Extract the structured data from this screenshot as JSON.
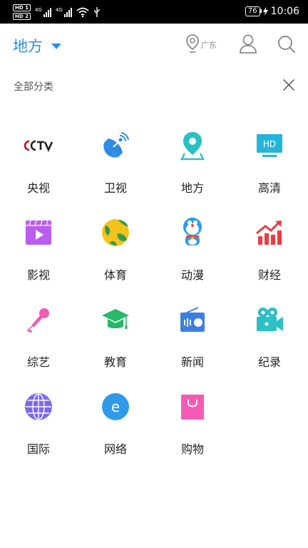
{
  "status_bar": {
    "hd1": "HD 1",
    "hd2": "HD 2",
    "net1": "4G",
    "net2": "4G",
    "battery": "76",
    "time": "10:06"
  },
  "header": {
    "title": "地方",
    "location_label": "广东"
  },
  "category_bar": {
    "label": "全部分类"
  },
  "categories": [
    {
      "label": "央视",
      "icon": "cctv-logo-icon"
    },
    {
      "label": "卫视",
      "icon": "satellite-dish-icon"
    },
    {
      "label": "地方",
      "icon": "map-pin-icon"
    },
    {
      "label": "高清",
      "icon": "hd-monitor-icon",
      "icon_text": "HD"
    },
    {
      "label": "影视",
      "icon": "film-play-icon"
    },
    {
      "label": "体育",
      "icon": "soccer-ball-icon"
    },
    {
      "label": "动漫",
      "icon": "doraemon-icon"
    },
    {
      "label": "财经",
      "icon": "finance-chart-icon"
    },
    {
      "label": "综艺",
      "icon": "microphone-icon"
    },
    {
      "label": "教育",
      "icon": "graduation-cap-icon"
    },
    {
      "label": "新闻",
      "icon": "radio-icon"
    },
    {
      "label": "纪录",
      "icon": "video-camera-icon"
    },
    {
      "label": "国际",
      "icon": "globe-icon"
    },
    {
      "label": "网络",
      "icon": "internet-e-icon",
      "icon_text": "e"
    },
    {
      "label": "购物",
      "icon": "shopping-bag-icon"
    }
  ],
  "colors": {
    "accent": "#2f8ce6",
    "teal": "#2bc0c6",
    "purple": "#b95df0",
    "red": "#ec3a43",
    "pink": "#f25ab4",
    "green": "#27b86a",
    "blue": "#3d7fe0",
    "globe": "#7a6be8",
    "bag": "#f55bb6"
  }
}
